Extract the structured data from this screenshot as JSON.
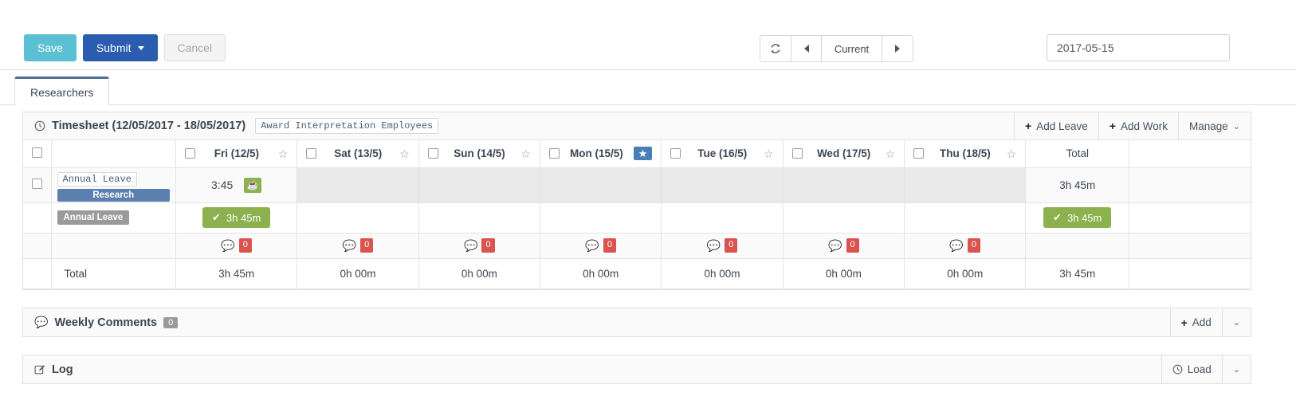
{
  "toolbar": {
    "save_label": "Save",
    "submit_label": "Submit",
    "cancel_label": "Cancel",
    "refresh_icon": "refresh-icon",
    "prev_label": "◄",
    "current_label": "Current",
    "next_label": "►",
    "date_value": "2017-05-15"
  },
  "tabs": [
    {
      "label": "Researchers",
      "active": true
    }
  ],
  "timesheet": {
    "clock_icon": "clock-icon",
    "title": "Timesheet (12/05/2017 - 18/05/2017)",
    "award_badge": "Award Interpretation Employees",
    "actions": {
      "add_leave": "Add Leave",
      "add_work": "Add Work",
      "manage": "Manage"
    },
    "columns": [
      {
        "label": "Fri (12/5)",
        "starred": false
      },
      {
        "label": "Sat (13/5)",
        "starred": false
      },
      {
        "label": "Sun (14/5)",
        "starred": false
      },
      {
        "label": "Mon (15/5)",
        "starred": true
      },
      {
        "label": "Tue (16/5)",
        "starred": false
      },
      {
        "label": "Wed (17/5)",
        "starred": false
      },
      {
        "label": "Thu (18/5)",
        "starred": false
      }
    ],
    "total_header": "Total",
    "entry_row": {
      "task_tag": "Annual Leave",
      "project_bar": "Research",
      "hours": [
        "3:45",
        "",
        "",
        "",
        "",
        "",
        ""
      ],
      "leave_icon": "coffee-break-icon",
      "row_total": "3h 45m"
    },
    "leave_row": {
      "label": "Annual Leave",
      "values": [
        "3h 45m",
        "",
        "",
        "",
        "",
        "",
        ""
      ],
      "check_icon": "check-icon",
      "row_total": "3h 45m"
    },
    "comments_row": {
      "icon": "comment-icon",
      "counts": [
        "0",
        "0",
        "0",
        "0",
        "0",
        "0",
        "0"
      ]
    },
    "totals_row": {
      "label": "Total",
      "values": [
        "3h 45m",
        "0h 00m",
        "0h 00m",
        "0h 00m",
        "0h 00m",
        "0h 00m",
        "0h 00m"
      ],
      "grand_total": "3h 45m"
    }
  },
  "weekly_comments": {
    "icon": "comment-icon",
    "title": "Weekly Comments",
    "count": "0",
    "add_label": "Add",
    "collapse_icon": "chevron-down-icon"
  },
  "log": {
    "icon": "edit-icon",
    "title": "Log",
    "load_label": "Load",
    "load_icon": "clock-icon",
    "collapse_icon": "chevron-down-icon"
  },
  "colors": {
    "save": "#5bc0d4",
    "submit": "#2a5db0",
    "green": "#8cb14e",
    "blue_bar": "#5b7fae",
    "star_active": "#4a7fb5",
    "red_badge": "#d9534f"
  }
}
